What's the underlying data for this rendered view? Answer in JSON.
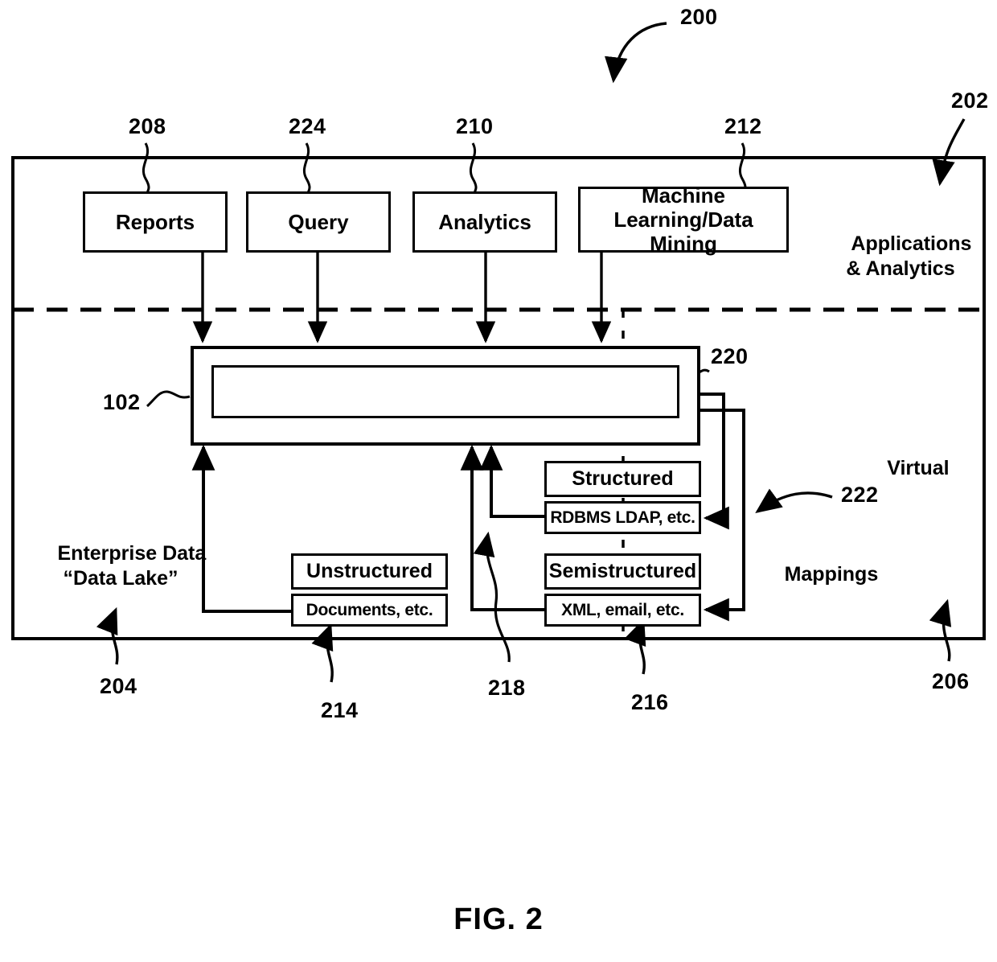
{
  "figure": {
    "caption": "FIG. 2",
    "overall_ref": "200"
  },
  "outer_frame": {
    "ref_top_right": "202",
    "ref_bottom_left": "204",
    "ref_bottom_right": "206"
  },
  "regions": {
    "applications_analytics": {
      "label": "Applications\n& Analytics",
      "ref": "202"
    },
    "enterprise_data": {
      "label": "Enterprise Data\n“Data Lake”",
      "ref": "204"
    },
    "virtual": {
      "label": "Virtual",
      "ref": "206"
    },
    "mappings": {
      "label": "Mappings",
      "ref": "222"
    }
  },
  "application_boxes": [
    {
      "label": "Reports",
      "ref": "208"
    },
    {
      "label": "Query",
      "ref": "224"
    },
    {
      "label": "Analytics",
      "ref": "210"
    },
    {
      "label": "Machine\nLearning/Data\nMining",
      "ref": "212"
    }
  ],
  "virtual_layer": {
    "outer_ref": "102",
    "inner_ref": "220",
    "outer_label": "",
    "inner_label": ""
  },
  "data_sources": [
    {
      "type_label": "Structured",
      "example_label": "RDBMS LDAP, etc.",
      "ref": "216"
    },
    {
      "type_label": "Semistructured",
      "example_label": "XML, email, etc.",
      "ref": "216"
    },
    {
      "type_label": "Unstructured",
      "example_label": "Documents, etc.",
      "ref": "214"
    }
  ],
  "reference_numerals": {
    "r200": "200",
    "r202": "202",
    "r204": "204",
    "r206": "206",
    "r208": "208",
    "r210": "210",
    "r212": "212",
    "r214": "214",
    "r216": "216",
    "r218": "218",
    "r220": "220",
    "r222": "222",
    "r224": "224",
    "r102": "102"
  },
  "colors": {
    "line": "#000000",
    "background": "#ffffff"
  }
}
